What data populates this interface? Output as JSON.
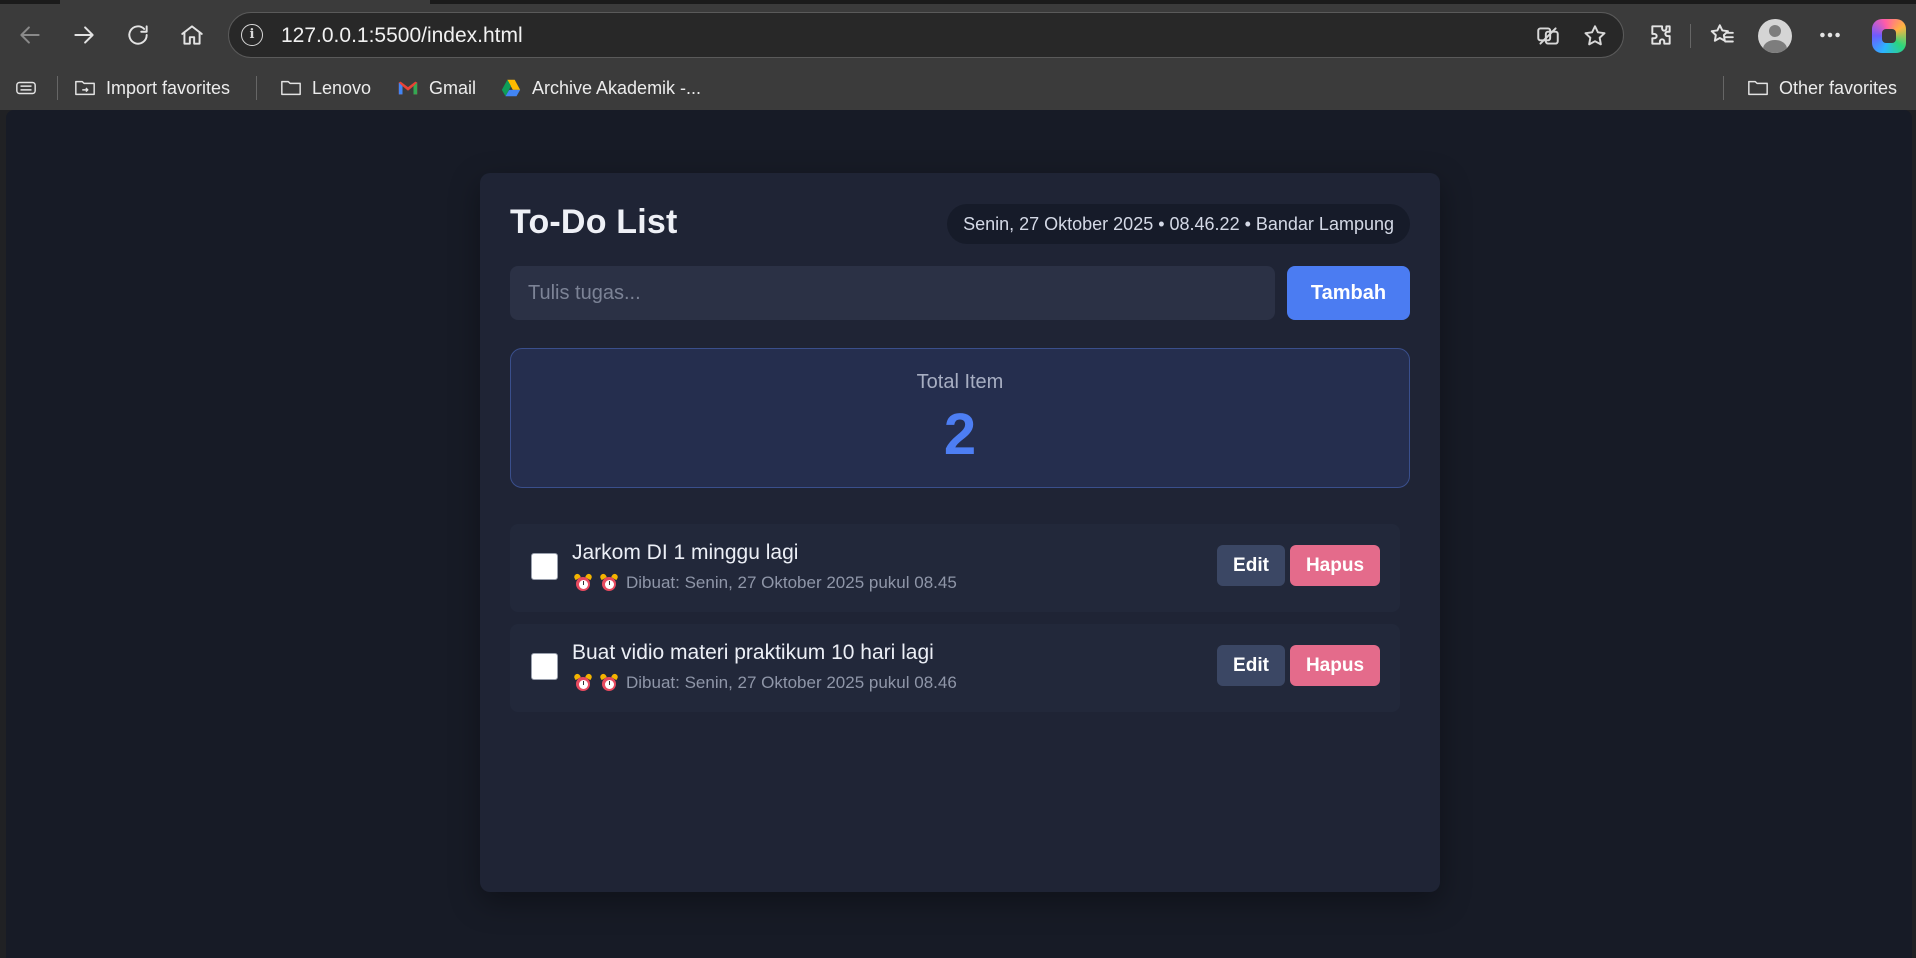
{
  "browser": {
    "url": "127.0.0.1:5500/index.html",
    "bookmarks": [
      {
        "label": "Import favorites",
        "icon": "import-folder-icon"
      },
      {
        "label": "Lenovo",
        "icon": "folder-icon"
      },
      {
        "label": "Gmail",
        "icon": "gmail-icon"
      },
      {
        "label": "Archive Akademik -...",
        "icon": "google-drive-icon"
      }
    ],
    "other_favorites": "Other favorites"
  },
  "app": {
    "title": "To-Do List",
    "datetime": "Senin, 27 Oktober 2025 • 08.46.22 • Bandar Lampung",
    "input_placeholder": "Tulis tugas...",
    "add_button": "Tambah",
    "total_label": "Total Item",
    "total_value": "2",
    "accent_color": "#4b7cf2",
    "delete_color": "#e46b8b",
    "todos": [
      {
        "title": "Jarkom DI 1 minggu lagi",
        "meta": "Dibuat: Senin, 27 Oktober 2025 pukul 08.45",
        "checked": false,
        "edit_label": "Edit",
        "delete_label": "Hapus"
      },
      {
        "title": "Buat vidio materi praktikum 10 hari lagi",
        "meta": "Dibuat: Senin, 27 Oktober 2025 pukul 08.46",
        "checked": false,
        "edit_label": "Edit",
        "delete_label": "Hapus"
      }
    ]
  }
}
